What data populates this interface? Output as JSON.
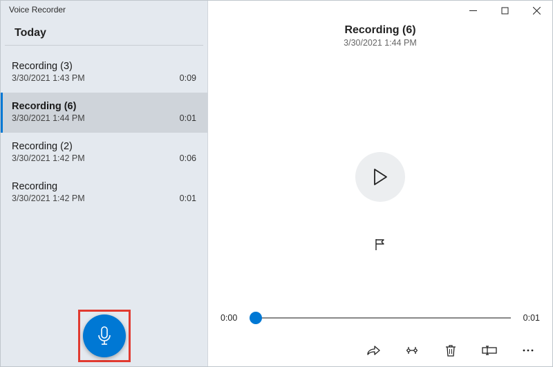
{
  "app": {
    "title": "Voice Recorder"
  },
  "sidebar": {
    "section_label": "Today",
    "items": [
      {
        "name": "Recording (3)",
        "date": "3/30/2021 1:43 PM",
        "duration": "0:09",
        "selected": false
      },
      {
        "name": "Recording (6)",
        "date": "3/30/2021 1:44 PM",
        "duration": "0:01",
        "selected": true
      },
      {
        "name": "Recording (2)",
        "date": "3/30/2021 1:42 PM",
        "duration": "0:06",
        "selected": false
      },
      {
        "name": "Recording",
        "date": "3/30/2021 1:42 PM",
        "duration": "0:01",
        "selected": false
      }
    ]
  },
  "detail": {
    "title": "Recording (6)",
    "date": "3/30/2021 1:44 PM",
    "position": "0:00",
    "duration": "0:01",
    "progress": 0.02
  },
  "colors": {
    "accent": "#0078d4",
    "highlight_border": "#e13a30"
  }
}
